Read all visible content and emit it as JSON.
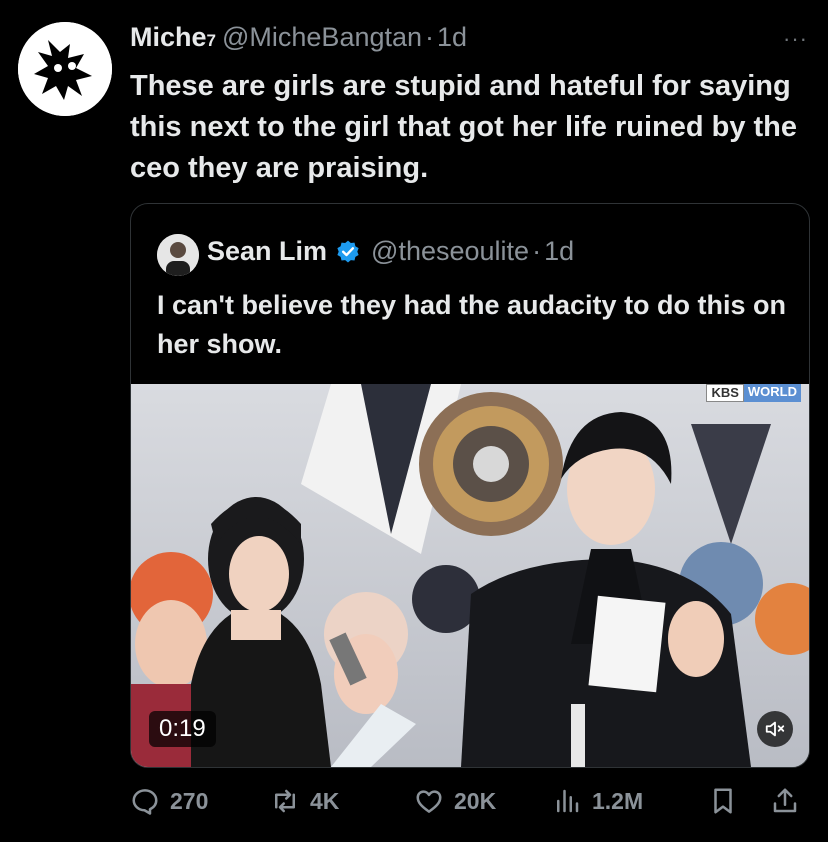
{
  "tweet": {
    "author_name": "Miche",
    "author_badge": "7",
    "handle": "@MicheBangtan",
    "separator": "·",
    "time": "1d",
    "more_label": "···",
    "text": "These are girls are stupid and hateful for saying this next to the girl that got her life ruined by the ceo they are praising."
  },
  "quote": {
    "author_name": "Sean Lim",
    "handle": "@theseoulite",
    "separator": "·",
    "time": "1d",
    "text": "I can't believe they had the audacity to do this on her show.",
    "video": {
      "duration": "0:19",
      "broadcaster_left": "KBS",
      "broadcaster_right": "WORLD"
    }
  },
  "actions": {
    "replies": "270",
    "reposts": "4K",
    "likes": "20K",
    "views": "1.2M"
  },
  "colors": {
    "background": "#000000",
    "text": "#e7e9ea",
    "muted": "#8b9299",
    "border": "#2f3336",
    "verified": "#1d9bf0"
  },
  "icons": [
    "reply-icon",
    "repost-icon",
    "like-icon",
    "views-icon",
    "bookmark-icon",
    "share-icon",
    "mute-icon",
    "verified-icon",
    "more-icon"
  ]
}
